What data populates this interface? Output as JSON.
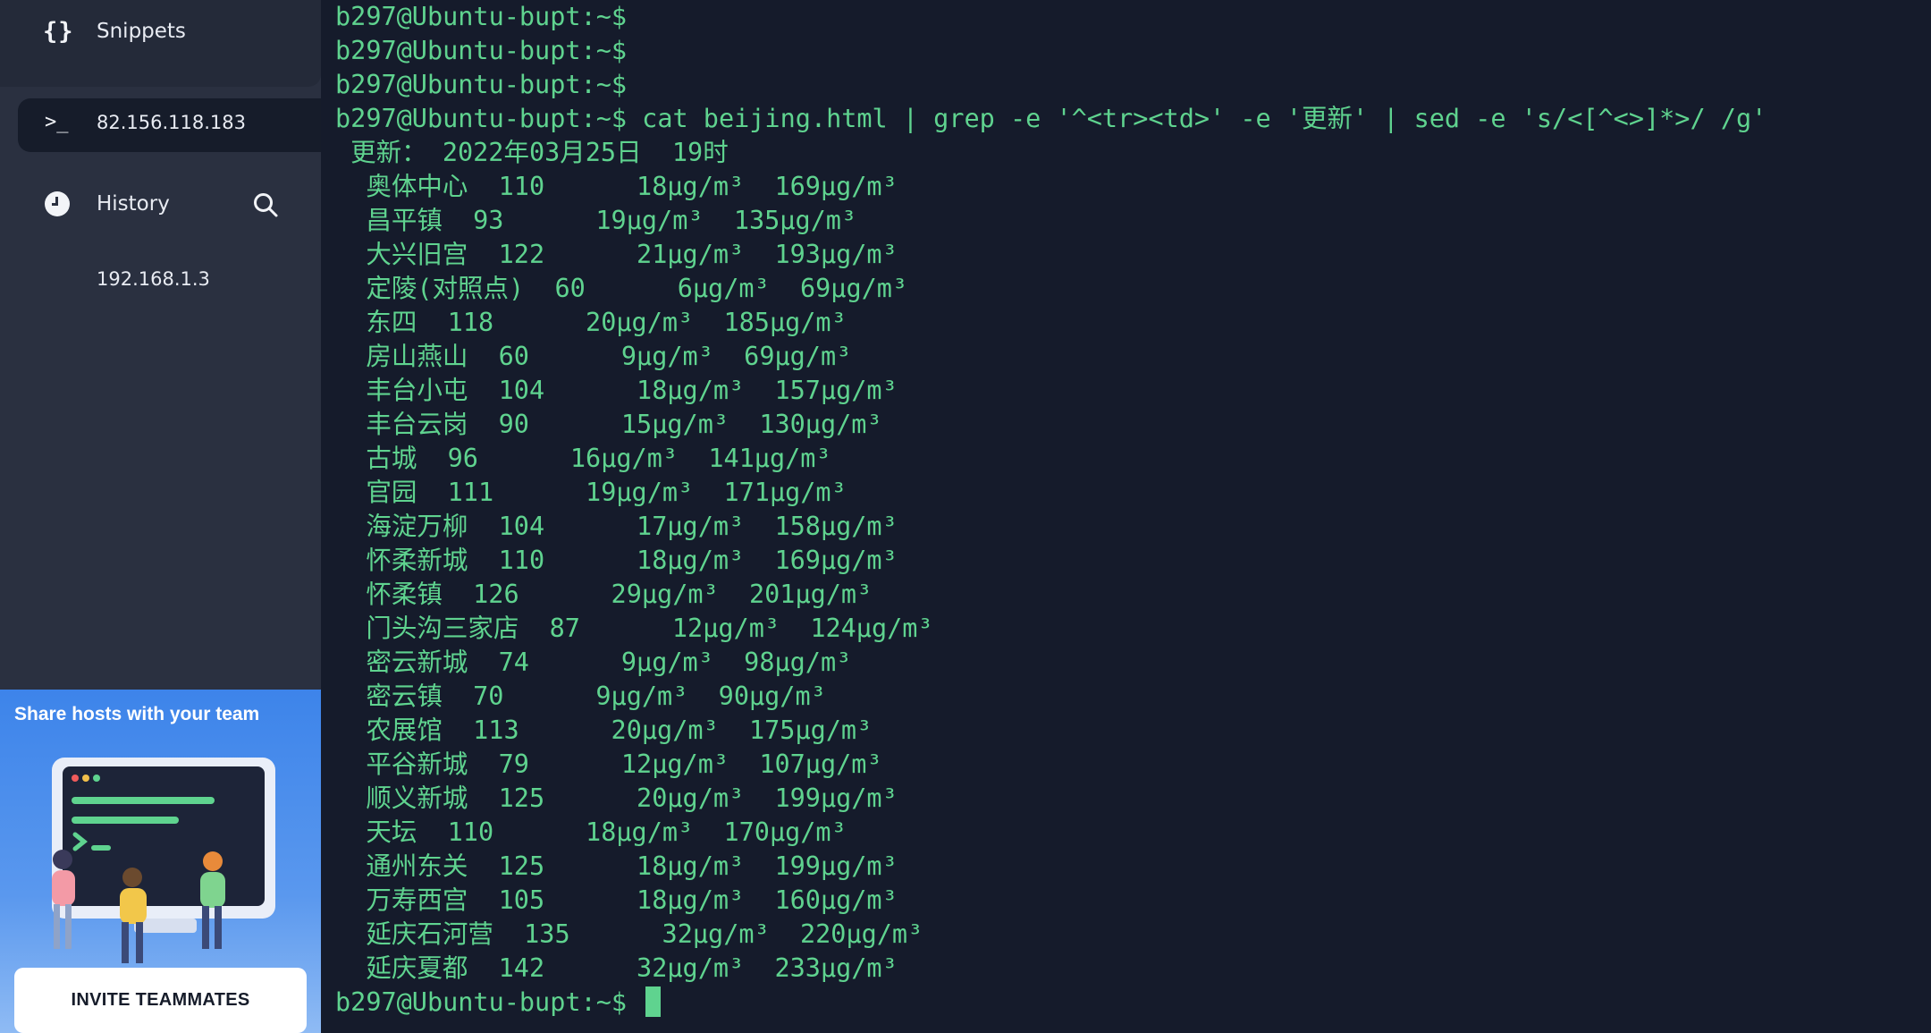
{
  "sidebar": {
    "snippets_icon": "{}",
    "snippets_label": "Snippets",
    "host_icon": ">_",
    "host_label": "82.156.118.183",
    "history_label": "History",
    "history_items": [
      "192.168.1.3"
    ],
    "promo": {
      "title": "Share hosts with your team",
      "button": "INVITE TEAMMATES"
    }
  },
  "terminal": {
    "lines": [
      "b297@Ubuntu-bupt:~$",
      "b297@Ubuntu-bupt:~$",
      "b297@Ubuntu-bupt:~$",
      "b297@Ubuntu-bupt:~$ cat beijing.html | grep -e '^<tr><td>' -e '更新' | sed -e 's/<[^<>]*>/ /g'",
      " 更新： 2022年03月25日  19时",
      "  奥体中心  110      18µg/m³  169µg/m³",
      "  昌平镇  93      19µg/m³  135µg/m³",
      "  大兴旧宫  122      21µg/m³  193µg/m³",
      "  定陵(对照点)  60      6µg/m³  69µg/m³",
      "  东四  118      20µg/m³  185µg/m³",
      "  房山燕山  60      9µg/m³  69µg/m³",
      "  丰台小屯  104      18µg/m³  157µg/m³",
      "  丰台云岗  90      15µg/m³  130µg/m³",
      "  古城  96      16µg/m³  141µg/m³",
      "  官园  111      19µg/m³  171µg/m³",
      "  海淀万柳  104      17µg/m³  158µg/m³",
      "  怀柔新城  110      18µg/m³  169µg/m³",
      "  怀柔镇  126      29µg/m³  201µg/m³",
      "  门头沟三家店  87      12µg/m³  124µg/m³",
      "  密云新城  74      9µg/m³  98µg/m³",
      "  密云镇  70      9µg/m³  90µg/m³",
      "  农展馆  113      20µg/m³  175µg/m³",
      "  平谷新城  79      12µg/m³  107µg/m³",
      "  顺义新城  125      20µg/m³  199µg/m³",
      "  天坛  110      18µg/m³  170µg/m³",
      "  通州东关  125      18µg/m³  199µg/m³",
      "  万寿西宫  105      18µg/m³  160µg/m³",
      "  延庆石河营  135      32µg/m³  220µg/m³",
      "  延庆夏都  142      32µg/m³  233µg/m³"
    ],
    "prompt": "b297@Ubuntu-bupt:~$ "
  },
  "colors": {
    "terminal_bg": "#151b2b",
    "terminal_fg": "#5fd38f",
    "sidebar_bg": "#2a3040",
    "promo_bg": "#3d84ea"
  }
}
